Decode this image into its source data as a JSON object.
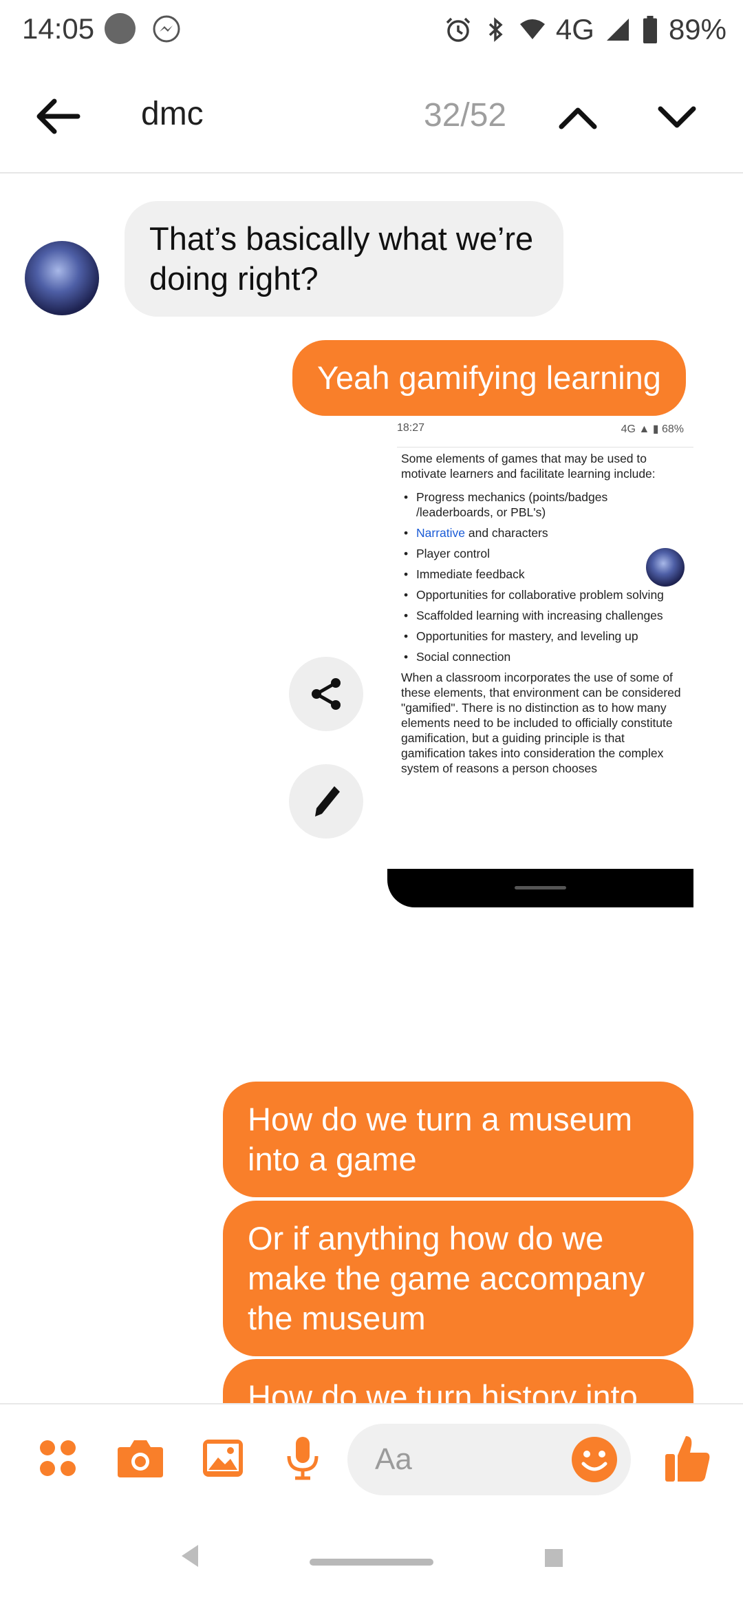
{
  "status_bar": {
    "time": "14:05",
    "network": "4G",
    "battery": "89%",
    "icons": [
      "notification-dot",
      "messenger-icon",
      "alarm-icon",
      "bluetooth-icon",
      "wifi-icon",
      "signal-icon",
      "battery-icon"
    ]
  },
  "header": {
    "search_term": "dmc",
    "match_count": "32/52"
  },
  "messages": [
    {
      "side": "incoming",
      "text": "That’s basically what we’re doing right?"
    },
    {
      "side": "outgoing",
      "text": "Yeah gamifying learning"
    },
    {
      "side": "outgoing",
      "text": "How do we turn a museum into a game"
    },
    {
      "side": "outgoing",
      "text": "Or if anything how do we make the game accompany the museum"
    },
    {
      "side": "outgoing",
      "text": "How do we turn history into"
    }
  ],
  "shared_screenshot": {
    "status_time": "18:27",
    "status_right": "4G ▲ ▮ 68%",
    "intro": "Some elements of games that may be used to motivate learners and facilitate learning include:",
    "items": [
      "Progress mechanics (points/badges /leaderboards, or PBL's)",
      "and characters",
      "Player control",
      "Immediate feedback",
      "Opportunities for collaborative problem solving",
      "Scaffolded learning with increasing challenges",
      "Opportunities for mastery, and leveling up",
      "Social connection"
    ],
    "link_word": "Narrative",
    "outro": "When a classroom incorporates the use of some of these elements, that environment can be considered \"gamified\". There is no distinction as to how many elements need to be included to officially constitute gamification, but a guiding principle is that gamification takes into consideration the complex system of reasons a person chooses"
  },
  "composer": {
    "placeholder": "Aa"
  },
  "colors": {
    "accent": "#f97f2a",
    "incoming_bubble": "#f0f0f0"
  }
}
